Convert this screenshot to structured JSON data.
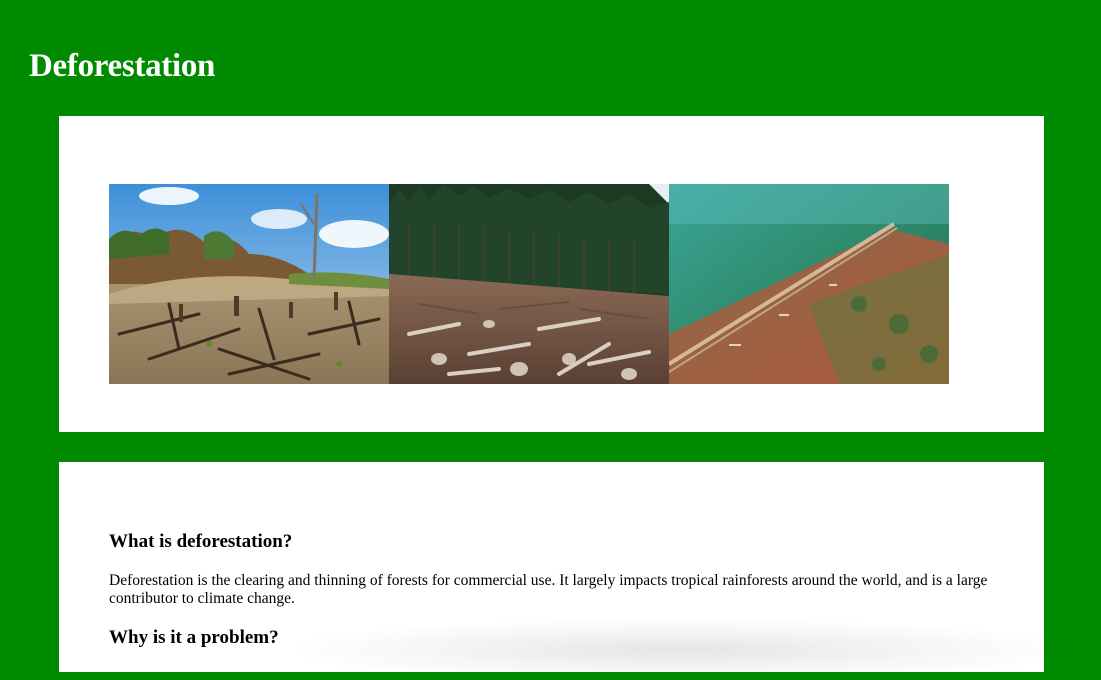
{
  "page": {
    "title": "Deforestation",
    "background_color": "#008a00"
  },
  "gallery": {
    "images": [
      {
        "alt": "slash-and-burn cleared land"
      },
      {
        "alt": "clear-cut forest with logs"
      },
      {
        "alt": "aerial view of logged forest"
      }
    ]
  },
  "content": {
    "heading_what": "What is deforestation?",
    "paragraph_what": "Deforestation is the clearing and thinning of forests for commercial use. It largely impacts tropical rainforests around the world, and is a large contributor to climate change.",
    "heading_why": "Why is it a problem?"
  }
}
